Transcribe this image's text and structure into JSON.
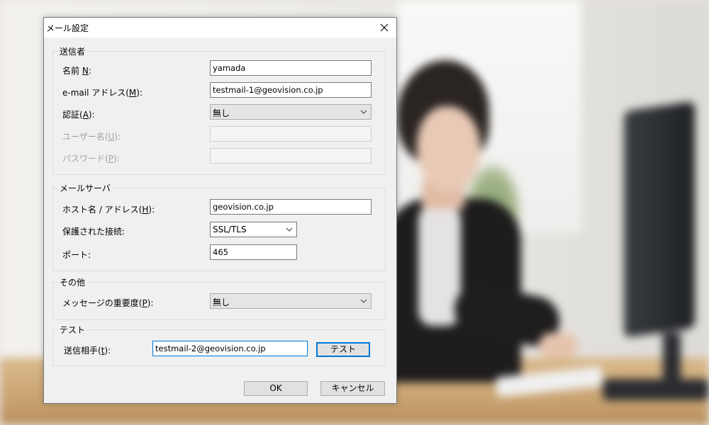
{
  "dialog": {
    "title": "メール設定",
    "sender": {
      "legend": "送信者",
      "name_label": "名前 ",
      "name_key": "N",
      "name_value": "yamada",
      "email_label": "e-mail アドレス(",
      "email_key": "M",
      "email_suffix": "):",
      "email_value": "testmail-1@geovision.co.jp",
      "auth_label": "認証(",
      "auth_key": "A",
      "auth_suffix": "):",
      "auth_value": "無し",
      "user_label": "ユーザー名(",
      "user_key": "U",
      "user_suffix": "):",
      "user_value": "",
      "pass_label": "パスワード(",
      "pass_key": "P",
      "pass_suffix": "):",
      "pass_value": ""
    },
    "server": {
      "legend": "メールサーバ",
      "host_label": "ホスト名 / アドレス(",
      "host_key": "H",
      "host_suffix": "):",
      "host_value": "geovision.co.jp",
      "secure_label": "保護された接続:",
      "secure_value": "SSL/TLS",
      "port_label": "ポート:",
      "port_value": "465"
    },
    "other": {
      "legend": "その他",
      "priority_label": "メッセージの重要度(",
      "priority_key": "P",
      "priority_suffix": "):",
      "priority_value": "無し"
    },
    "test": {
      "legend": "テスト",
      "to_label": "送信相手(",
      "to_key": "t",
      "to_suffix": "):",
      "to_value": "testmail-2@geovision.co.jp",
      "test_button": "テスト"
    },
    "ok_button": "OK",
    "cancel_button": "キャンセル"
  },
  "colors": {
    "accent": "#0078d7",
    "dialog_bg": "#f0f0f0",
    "disabled_text": "#a0a0a0"
  }
}
